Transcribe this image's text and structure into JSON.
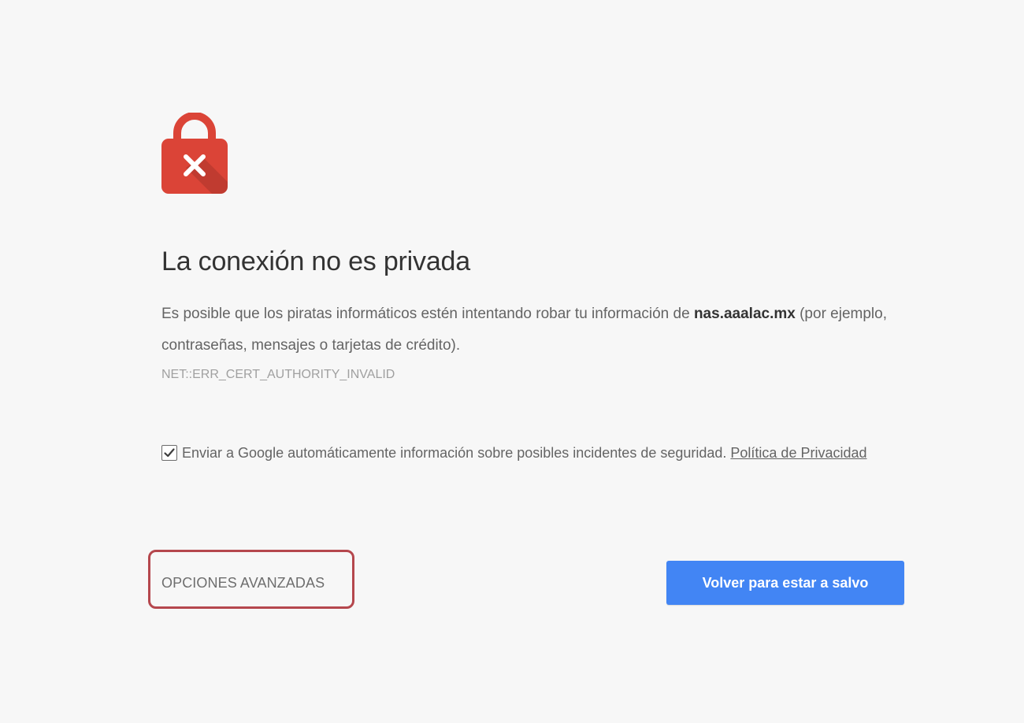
{
  "colors": {
    "background": "#f7f7f7",
    "lock_red": "#db4437",
    "primary_blue": "#4285f4",
    "highlight_outline": "#b5474d"
  },
  "icon": {
    "name": "lock-error-icon"
  },
  "heading": "La conexión no es privada",
  "explanation": {
    "before": "Es posible que los piratas informáticos estén intentando robar tu información de ",
    "hostname": "nas.aaalac.mx",
    "after": " (por ejemplo, contraseñas, mensajes o tarjetas de crédito)."
  },
  "error_code": "NET::ERR_CERT_AUTHORITY_INVALID",
  "report": {
    "checked": true,
    "label": "Enviar a Google automáticamente información sobre posibles incidentes de seguridad. ",
    "link_label": "Política de Privacidad"
  },
  "buttons": {
    "advanced_label": "OPCIONES AVANZADAS",
    "back_label": "Volver para estar a salvo"
  }
}
